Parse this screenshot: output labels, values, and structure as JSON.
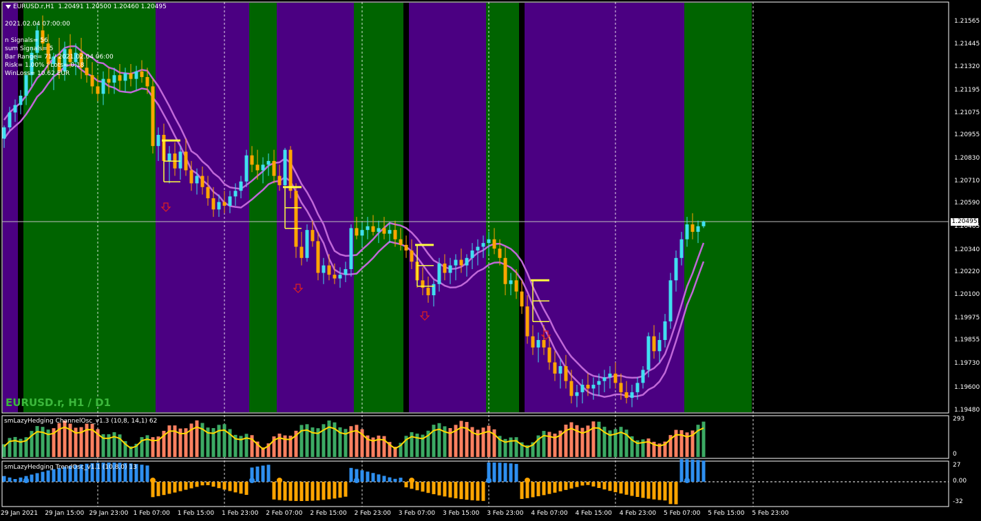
{
  "header": {
    "symbol_tf": "EURUSD.r,H1",
    "ohlc": "1.20491 1.20500 1.20460 1.20495"
  },
  "info_lines": [
    "2021.02.04 07:00:00",
    "n Signals= 56",
    " sum Signals= 5",
    "Bar Range= 71  / 2021.02.04 06:00",
    "Risk= 1.00%  / Lots= 0.18",
    "WinLoss= 10.62 EUR"
  ],
  "symbol_label": "EURUSD.r, H1 / D1",
  "colors": {
    "green_zone": "#006400",
    "purple_zone": "#4b0082",
    "bull": "#40e0f0",
    "bear": "#ffa500",
    "ma": "#c068d8",
    "signal": "#ffff40",
    "arrow": "#e02020",
    "osc_red": "#fa8060",
    "osc_green": "#3caa64",
    "osc_line": "#ffd700",
    "trend_blue": "#2e8ff0",
    "trend_orange": "#ffa500"
  },
  "price_axis": [
    "1.21565",
    "1.21445",
    "1.21320",
    "1.21195",
    "1.21075",
    "1.20955",
    "1.20830",
    "1.20710",
    "1.20590",
    "1.20465",
    "1.20340",
    "1.20220",
    "1.20100",
    "1.19975",
    "1.19855",
    "1.19730",
    "1.19600",
    "1.19480"
  ],
  "current_price": "1.20495",
  "time_axis": [
    "29 Jan 2021",
    "29 Jan 15:00",
    "29 Jan 23:00",
    "1 Feb 07:00",
    "1 Feb 15:00",
    "1 Feb 23:00",
    "2 Feb 07:00",
    "2 Feb 15:00",
    "2 Feb 23:00",
    "3 Feb 07:00",
    "3 Feb 15:00",
    "3 Feb 23:00",
    "4 Feb 07:00",
    "4 Feb 15:00",
    "4 Feb 23:00",
    "5 Feb 07:00",
    "5 Feb 15:00",
    "5 Feb 23:00"
  ],
  "channel_osc": {
    "label": "smLazyHedging ChannelOsc_v1.3  (10,8, 14,1)  62",
    "axis_top": "293",
    "axis_bottom": "0"
  },
  "trend_osc": {
    "label": "smLazyHedging TrendOsc_v1.1  (10,8,0)  13",
    "axis_top": "27",
    "axis_mid": "0.00",
    "axis_bottom": "-32"
  },
  "zones": [
    {
      "from": 0,
      "to": 2,
      "color": "purple"
    },
    {
      "from": 4,
      "to": 27,
      "color": "green"
    },
    {
      "from": 28,
      "to": 44,
      "color": "purple"
    },
    {
      "from": 45,
      "to": 49,
      "color": "green"
    },
    {
      "from": 50,
      "to": 64,
      "color": "purple"
    },
    {
      "from": 64,
      "to": 72,
      "color": "green"
    },
    {
      "from": 74,
      "to": 87,
      "color": "purple"
    },
    {
      "from": 88,
      "to": 93,
      "color": "green"
    },
    {
      "from": 95,
      "to": 123,
      "color": "purple"
    },
    {
      "from": 124,
      "to": 136,
      "color": "green"
    }
  ],
  "candles": [
    [
      1.2094,
      1.2101,
      1.2089,
      1.21
    ],
    [
      1.21,
      1.2111,
      1.2098,
      1.2108
    ],
    [
      1.2108,
      1.2115,
      1.2103,
      1.2112
    ],
    [
      1.2112,
      1.212,
      1.2107,
      1.2117
    ],
    [
      1.2117,
      1.213,
      1.2112,
      1.2128
    ],
    [
      1.2128,
      1.2143,
      1.2122,
      1.214
    ],
    [
      1.214,
      1.2156,
      1.2136,
      1.2152
    ],
    [
      1.2152,
      1.216,
      1.2141,
      1.2145
    ],
    [
      1.2145,
      1.215,
      1.213,
      1.2134
    ],
    [
      1.2134,
      1.214,
      1.212,
      1.2138
    ],
    [
      1.2138,
      1.2148,
      1.2126,
      1.213
    ],
    [
      1.213,
      1.2146,
      1.2125,
      1.2142
    ],
    [
      1.2142,
      1.215,
      1.2132,
      1.2135
    ],
    [
      1.2135,
      1.2145,
      1.2128,
      1.214
    ],
    [
      1.214,
      1.2148,
      1.2126,
      1.2132
    ],
    [
      1.2132,
      1.2138,
      1.2124,
      1.2128
    ],
    [
      1.2128,
      1.2135,
      1.2118,
      1.2122
    ],
    [
      1.2122,
      1.2128,
      1.2114,
      1.2118
    ],
    [
      1.2118,
      1.213,
      1.2112,
      1.2126
    ],
    [
      1.2126,
      1.2132,
      1.2118,
      1.2124
    ],
    [
      1.2124,
      1.2132,
      1.2118,
      1.2128
    ],
    [
      1.2128,
      1.2134,
      1.212,
      1.2125
    ],
    [
      1.2125,
      1.2132,
      1.2119,
      1.2129
    ],
    [
      1.2129,
      1.2134,
      1.2122,
      1.2126
    ],
    [
      1.2126,
      1.2133,
      1.212,
      1.213
    ],
    [
      1.213,
      1.2136,
      1.2124,
      1.2127
    ],
    [
      1.2127,
      1.2132,
      1.2118,
      1.2122
    ],
    [
      1.2122,
      1.2126,
      1.2086,
      1.209
    ],
    [
      1.209,
      1.21,
      1.2082,
      1.2096
    ],
    [
      1.2096,
      1.2102,
      1.2078,
      1.2082
    ],
    [
      1.2082,
      1.209,
      1.207,
      1.2086
    ],
    [
      1.2086,
      1.2092,
      1.2074,
      1.2078
    ],
    [
      1.2078,
      1.209,
      1.2072,
      1.2087
    ],
    [
      1.2087,
      1.2094,
      1.2074,
      1.2077
    ],
    [
      1.2077,
      1.2082,
      1.2066,
      1.207
    ],
    [
      1.207,
      1.2078,
      1.2064,
      1.2074
    ],
    [
      1.2074,
      1.2079,
      1.2064,
      1.2068
    ],
    [
      1.2068,
      1.2074,
      1.2058,
      1.2062
    ],
    [
      1.2062,
      1.2068,
      1.2052,
      1.2056
    ],
    [
      1.2056,
      1.2064,
      1.2052,
      1.206
    ],
    [
      1.206,
      1.2066,
      1.2054,
      1.2058
    ],
    [
      1.2058,
      1.2066,
      1.2054,
      1.2063
    ],
    [
      1.2063,
      1.207,
      1.2058,
      1.2066
    ],
    [
      1.2066,
      1.2074,
      1.2062,
      1.2071
    ],
    [
      1.2071,
      1.2088,
      1.2068,
      1.2085
    ],
    [
      1.2085,
      1.209,
      1.2076,
      1.208
    ],
    [
      1.208,
      1.2088,
      1.2072,
      1.2077
    ],
    [
      1.2077,
      1.2084,
      1.207,
      1.208
    ],
    [
      1.208,
      1.2086,
      1.2074,
      1.2082
    ],
    [
      1.2082,
      1.2088,
      1.207,
      1.2074
    ],
    [
      1.2074,
      1.208,
      1.2066,
      1.2069
    ],
    [
      1.2069,
      1.2089,
      1.2066,
      1.2088
    ],
    [
      1.2088,
      1.209,
      1.2062,
      1.2066
    ],
    [
      1.2066,
      1.207,
      1.203,
      1.2036
    ],
    [
      1.2036,
      1.2044,
      1.2026,
      1.203
    ],
    [
      1.203,
      1.2048,
      1.2028,
      1.2045
    ],
    [
      1.2045,
      1.205,
      1.2036,
      1.2039
    ],
    [
      1.2039,
      1.2044,
      1.2018,
      1.2022
    ],
    [
      1.2022,
      1.203,
      1.2016,
      1.2026
    ],
    [
      1.2026,
      1.2032,
      1.2018,
      1.2021
    ],
    [
      1.2021,
      1.2027,
      1.2016,
      1.2019
    ],
    [
      1.2019,
      1.2025,
      1.2014,
      1.2021
    ],
    [
      1.2021,
      1.2028,
      1.2017,
      1.2024
    ],
    [
      1.2024,
      1.2048,
      1.202,
      1.2046
    ],
    [
      1.2046,
      1.2052,
      1.204,
      1.2042
    ],
    [
      1.2042,
      1.2049,
      1.2036,
      1.2045
    ],
    [
      1.2045,
      1.2052,
      1.204,
      1.2047
    ],
    [
      1.2047,
      1.2053,
      1.2042,
      1.2044
    ],
    [
      1.2044,
      1.205,
      1.2038,
      1.2046
    ],
    [
      1.2046,
      1.2052,
      1.204,
      1.2043
    ],
    [
      1.2043,
      1.2049,
      1.2038,
      1.2045
    ],
    [
      1.2045,
      1.205,
      1.2036,
      1.204
    ],
    [
      1.204,
      1.2046,
      1.2034,
      1.2037
    ],
    [
      1.2037,
      1.2042,
      1.203,
      1.2034
    ],
    [
      1.2034,
      1.204,
      1.2024,
      1.2028
    ],
    [
      1.2028,
      1.2034,
      1.2014,
      1.2018
    ],
    [
      1.2018,
      1.2025,
      1.201,
      1.2014
    ],
    [
      1.2014,
      1.202,
      1.2006,
      1.201
    ],
    [
      1.201,
      1.2018,
      1.2004,
      1.2016
    ],
    [
      1.2016,
      1.203,
      1.2012,
      1.2027
    ],
    [
      1.2027,
      1.2032,
      1.2018,
      1.2022
    ],
    [
      1.2022,
      1.203,
      1.2016,
      1.2026
    ],
    [
      1.2026,
      1.2032,
      1.2018,
      1.2029
    ],
    [
      1.2029,
      1.2035,
      1.2022,
      1.2026
    ],
    [
      1.2026,
      1.2032,
      1.202,
      1.203
    ],
    [
      1.203,
      1.2038,
      1.2024,
      1.2034
    ],
    [
      1.2034,
      1.204,
      1.2026,
      1.2036
    ],
    [
      1.2036,
      1.2042,
      1.203,
      1.2038
    ],
    [
      1.2038,
      1.2044,
      1.2032,
      1.204
    ],
    [
      1.204,
      1.2046,
      1.2032,
      1.2035
    ],
    [
      1.2035,
      1.204,
      1.2026,
      1.203
    ],
    [
      1.203,
      1.2036,
      1.201,
      1.2016
    ],
    [
      1.2016,
      1.2022,
      1.201,
      1.2018
    ],
    [
      1.2018,
      1.2024,
      1.2008,
      1.2012
    ],
    [
      1.2012,
      1.2018,
      1.2,
      1.2004
    ],
    [
      1.2004,
      1.201,
      1.1984,
      1.1988
    ],
    [
      1.1988,
      1.1994,
      1.1978,
      1.1982
    ],
    [
      1.1982,
      1.199,
      1.1974,
      1.1986
    ],
    [
      1.1986,
      1.1994,
      1.1978,
      1.1982
    ],
    [
      1.1982,
      1.1988,
      1.197,
      1.1974
    ],
    [
      1.1974,
      1.198,
      1.1964,
      1.1968
    ],
    [
      1.1968,
      1.1976,
      1.196,
      1.1972
    ],
    [
      1.1972,
      1.1978,
      1.196,
      1.1964
    ],
    [
      1.1964,
      1.197,
      1.1952,
      1.1956
    ],
    [
      1.1956,
      1.1962,
      1.195,
      1.1958
    ],
    [
      1.1958,
      1.1965,
      1.1952,
      1.1962
    ],
    [
      1.1962,
      1.1968,
      1.1956,
      1.196
    ],
    [
      1.196,
      1.1966,
      1.1954,
      1.1962
    ],
    [
      1.1962,
      1.1968,
      1.1956,
      1.1964
    ],
    [
      1.1964,
      1.197,
      1.1958,
      1.1966
    ],
    [
      1.1966,
      1.1972,
      1.196,
      1.1968
    ],
    [
      1.1968,
      1.1974,
      1.196,
      1.1963
    ],
    [
      1.1963,
      1.1968,
      1.1954,
      1.1958
    ],
    [
      1.1958,
      1.1964,
      1.1952,
      1.1955
    ],
    [
      1.1955,
      1.1962,
      1.195,
      1.1958
    ],
    [
      1.1958,
      1.1966,
      1.1954,
      1.1963
    ],
    [
      1.1963,
      1.1972,
      1.196,
      1.197
    ],
    [
      1.197,
      1.199,
      1.1966,
      1.1988
    ],
    [
      1.1988,
      1.1994,
      1.1976,
      1.198
    ],
    [
      1.198,
      1.199,
      1.1974,
      1.1986
    ],
    [
      1.1986,
      1.2,
      1.1982,
      1.1996
    ],
    [
      1.1996,
      1.2022,
      1.1992,
      1.2018
    ],
    [
      1.2018,
      1.2034,
      1.2012,
      1.203
    ],
    [
      1.203,
      1.2044,
      1.2026,
      1.204
    ],
    [
      1.204,
      1.2052,
      1.2036,
      1.2048
    ],
    [
      1.2048,
      1.2054,
      1.204,
      1.2044
    ],
    [
      1.2044,
      1.205,
      1.2038,
      1.2047
    ],
    [
      1.2047,
      1.205,
      1.2046,
      1.20495
    ]
  ]
}
